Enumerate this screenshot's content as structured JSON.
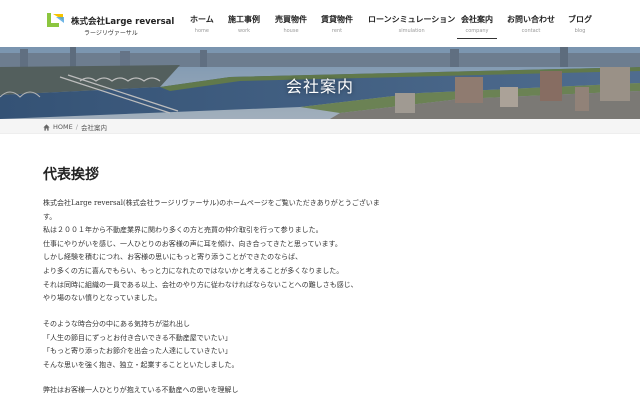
{
  "header": {
    "logo": {
      "company_name": "株式会社Large reversal",
      "company_kana": "ラージリヴァーサル",
      "logo_mark_text": "Large reversal"
    },
    "nav": [
      {
        "label": "ホーム",
        "sub": "home",
        "active": false
      },
      {
        "label": "施工事例",
        "sub": "work",
        "active": false
      },
      {
        "label": "売買物件",
        "sub": "house",
        "active": false
      },
      {
        "label": "賃貸物件",
        "sub": "rent",
        "active": false
      },
      {
        "label": "ローンシミュレーション",
        "sub": "simulation",
        "active": false
      },
      {
        "label": "会社案内",
        "sub": "company",
        "active": true
      },
      {
        "label": "お問い合わせ",
        "sub": "contact",
        "active": false
      },
      {
        "label": "ブログ",
        "sub": "blog",
        "active": false
      }
    ]
  },
  "hero": {
    "title": "会社案内"
  },
  "breadcrumb": {
    "home": "HOME",
    "separator": "/",
    "current": "会社案内"
  },
  "main": {
    "heading": "代表挨拶",
    "paragraph1": [
      "株式会社Large reversal(株式会社ラージリヴァーサル)のホームページをご覧いただきありがとうございま",
      "す。",
      "私は２００１年から不動産業界に関わり多くの方と売買の仲介取引を行って参りました。",
      "仕事にやりがいを感じ、一人ひとりのお客様の声に耳を傾け、向き合ってきたと思っています。",
      "しかし経験を積むにつれ、お客様の思いにもっと寄り添うことができたのならば、",
      "より多くの方に喜んでもらい、もっと力になれたのではないかと考えることが多くなりました。",
      "それは同時に組織の一員である以上、会社のやり方に従わなければならないことへの難しさも感じ、",
      "やり場のない憤りとなっていました。"
    ],
    "paragraph2": [
      "そのような時合分の中にある気持ちが溢れ出し",
      "「人生の節目にずっとお付き合いできる不動産屋でいたい」",
      "「もっと寄り添ったお節介を出会った人達にしていきたい」",
      "そんな思いを強く抱き、独立・起業することといたしました。"
    ],
    "paragraph3": [
      "弊社はお客様一人ひとりが抱えている不動産への思いを理解し"
    ]
  },
  "colors": {
    "accent": "#333333",
    "logo_green": "#8cc63f",
    "breadcrumb_bg": "#f5f5f5"
  },
  "icons": {
    "breadcrumb_home": "home-icon"
  }
}
